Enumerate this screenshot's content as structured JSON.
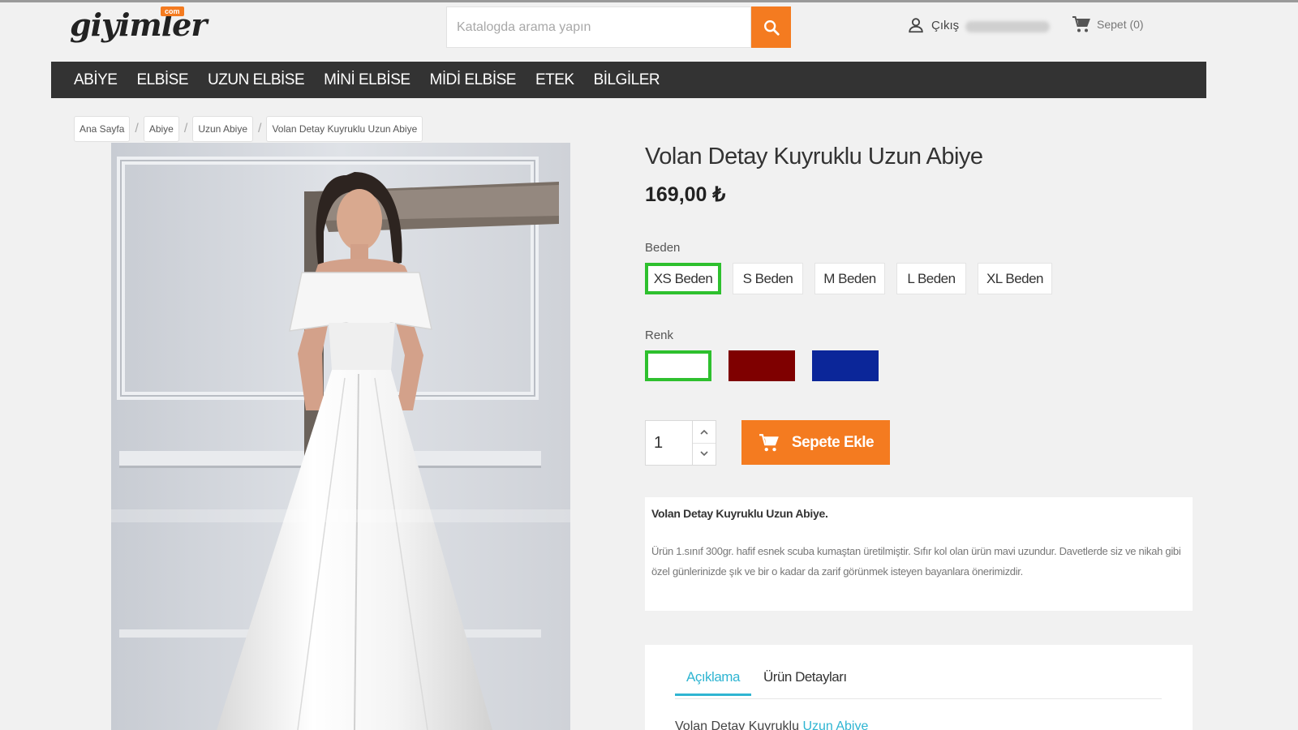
{
  "header": {
    "logo_text": "giyimler",
    "logo_badge": "com",
    "search_placeholder": "Katalogda arama yapın",
    "login_label": "Çıkış",
    "cart_label": "Sepet (0)"
  },
  "nav": {
    "items": [
      "ABİYE",
      "ELBİSE",
      "UZUN ELBİSE",
      "MİNİ ELBİSE",
      "MİDİ ELBİSE",
      "ETEK",
      "BİLGİLER"
    ]
  },
  "breadcrumb": [
    "Ana Sayfa",
    "Abiye",
    "Uzun Abiye",
    "Volan Detay Kuyruklu Uzun Abiye"
  ],
  "product": {
    "title": "Volan Detay Kuyruklu Uzun Abiye",
    "price": "169,00 ₺",
    "size_label": "Beden",
    "sizes": [
      "XS Beden",
      "S Beden",
      "M Beden",
      "L Beden",
      "XL Beden"
    ],
    "selected_size": "XS Beden",
    "color_label": "Renk",
    "colors": [
      "#ffffff",
      "#7f0000",
      "#0b2699"
    ],
    "selected_color": "#ffffff",
    "quantity": "1",
    "add_to_cart_label": "Sepete Ekle"
  },
  "description": {
    "title": "Volan Detay Kuyruklu Uzun Abiye.",
    "text": "Ürün 1.sınıf 300gr. hafif esnek scuba kumaştan üretilmiştir. Sıfır kol olan ürün mavi uzundur. Davetlerde siz ve nikah gibi özel günlerinizde şık ve bir o kadar da zarif görünmek isteyen bayanlara önerimizdir."
  },
  "tabs": {
    "items": [
      "Açıklama",
      "Ürün Detayları"
    ],
    "active": "Açıklama",
    "content_prefix": "Volan Detay Kuyruklu",
    "content_link": "Uzun Abiye"
  },
  "colors": {
    "accent": "#f47b20",
    "nav_bg": "#333333",
    "selected_border": "#2ec02e",
    "tab_active": "#2fb5d2"
  }
}
